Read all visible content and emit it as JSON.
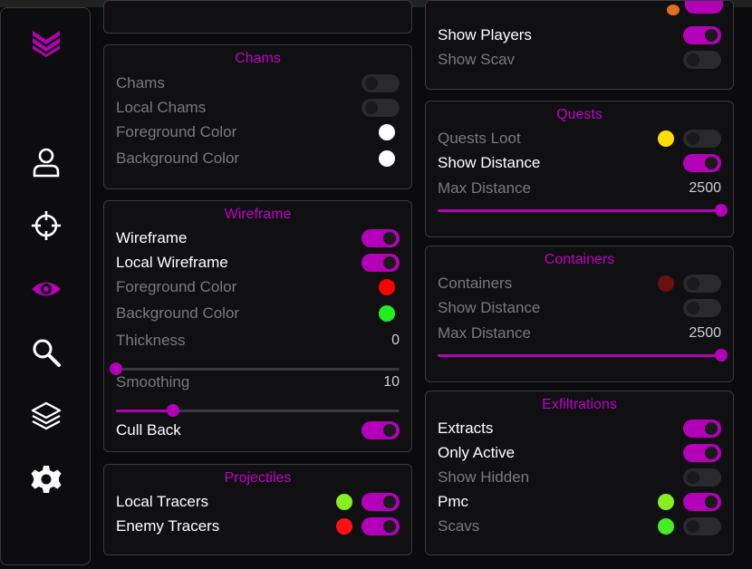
{
  "colors": {
    "accent": "#b400b8",
    "title": "#c000c8",
    "enabled_text": "#ffffff",
    "disabled_text": "#7a7a7e"
  },
  "sidebar": {
    "items": [
      {
        "icon": "logo-chevrons-icon"
      },
      {
        "icon": "user-icon"
      },
      {
        "icon": "crosshair-icon"
      },
      {
        "icon": "eye-icon",
        "active": true
      },
      {
        "icon": "search-icon"
      },
      {
        "icon": "layers-icon"
      },
      {
        "icon": "gear-icon"
      }
    ]
  },
  "chams": {
    "title": "Chams",
    "chams": {
      "label": "Chams",
      "enabled": false
    },
    "local_chams": {
      "label": "Local Chams",
      "enabled": false
    },
    "foreground": {
      "label": "Foreground Color",
      "color": "#ffffff"
    },
    "background": {
      "label": "Background Color",
      "color": "#ffffff"
    }
  },
  "wireframe": {
    "title": "Wireframe",
    "wireframe": {
      "label": "Wireframe",
      "enabled": true
    },
    "local_wireframe": {
      "label": "Local Wireframe",
      "enabled": true
    },
    "foreground": {
      "label": "Foreground Color",
      "color": "#ff0000"
    },
    "background": {
      "label": "Background Color",
      "color": "#22ee22"
    },
    "thickness": {
      "label": "Thickness",
      "value": "0",
      "fraction": 0.0
    },
    "smoothing": {
      "label": "Smoothing",
      "value": "10",
      "fraction": 0.2
    },
    "cull_back": {
      "label": "Cull Back",
      "enabled": true
    }
  },
  "projectiles": {
    "title": "Projectiles",
    "local_tracers": {
      "label": "Local Tracers",
      "enabled": true,
      "color": "#88ee22"
    },
    "enemy_tracers": {
      "label": "Enemy Tracers",
      "enabled": true,
      "color": "#ff1111"
    }
  },
  "players": {
    "show_players": {
      "label": "Show Players",
      "enabled": true
    },
    "show_scav": {
      "label": "Show Scav",
      "enabled": false
    }
  },
  "quests": {
    "title": "Quests",
    "quests_loot": {
      "label": "Quests Loot",
      "enabled": false,
      "color": "#ffdd00"
    },
    "show_distance": {
      "label": "Show Distance",
      "enabled": true
    },
    "max_distance": {
      "label": "Max Distance",
      "value": "2500",
      "fraction": 1.0
    }
  },
  "containers": {
    "title": "Containers",
    "containers": {
      "label": "Containers",
      "enabled": false,
      "color": "#6a1010"
    },
    "show_distance": {
      "label": "Show Distance",
      "enabled": false
    },
    "max_distance": {
      "label": "Max Distance",
      "value": "2500",
      "fraction": 1.0
    }
  },
  "exfiltrations": {
    "title": "Exfiltrations",
    "extracts": {
      "label": "Extracts",
      "enabled": true
    },
    "only_active": {
      "label": "Only Active",
      "enabled": true
    },
    "show_hidden": {
      "label": "Show Hidden",
      "enabled": false
    },
    "pmc": {
      "label": "Pmc",
      "enabled": true,
      "color": "#88ee22"
    },
    "scavs": {
      "label": "Scavs",
      "enabled": false,
      "color": "#44ee22"
    }
  }
}
